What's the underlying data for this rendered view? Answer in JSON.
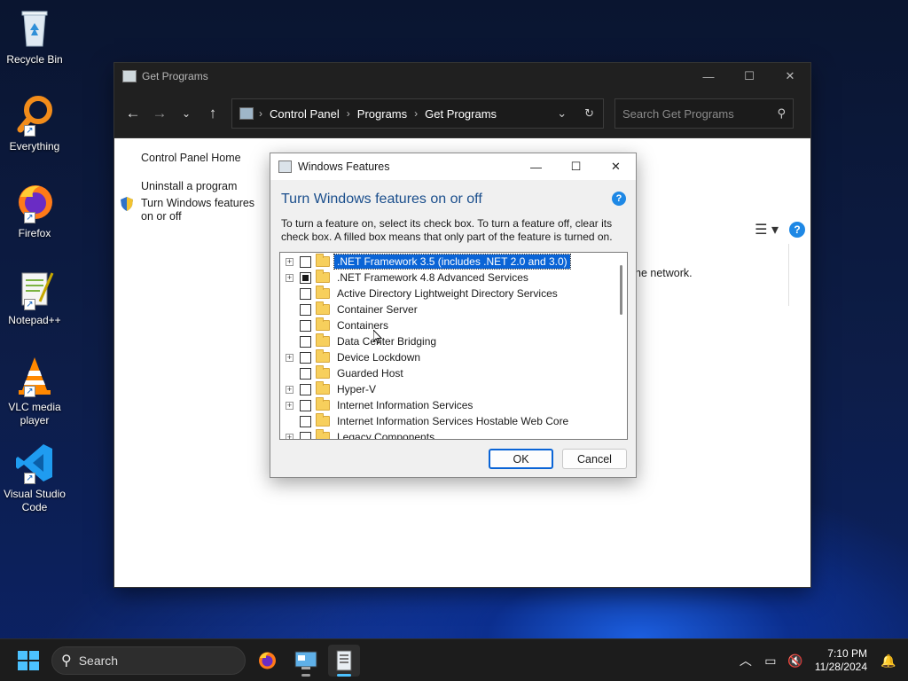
{
  "desktop": {
    "icons": [
      {
        "label": "Recycle Bin"
      },
      {
        "label": "Everything"
      },
      {
        "label": "Firefox"
      },
      {
        "label": "Notepad++"
      },
      {
        "label": "VLC media player"
      },
      {
        "label": "Visual Studio Code"
      }
    ]
  },
  "explorer": {
    "title": "Get Programs",
    "breadcrumb": [
      "Control Panel",
      "Programs",
      "Get Programs"
    ],
    "search_placeholder": "Search Get Programs",
    "sidebar": {
      "home": "Control Panel Home",
      "uninstall": "Uninstall a program",
      "features": "Turn Windows features on or off"
    },
    "partial_text": "he network."
  },
  "dialog": {
    "title": "Windows Features",
    "heading": "Turn Windows features on or off",
    "description": "To turn a feature on, select its check box. To turn a feature off, clear its check box. A filled box means that only part of the feature is turned on.",
    "features": [
      {
        "label": ".NET Framework 3.5 (includes .NET 2.0 and 3.0)",
        "expandable": true,
        "state": "unchecked",
        "selected": true
      },
      {
        "label": ".NET Framework 4.8 Advanced Services",
        "expandable": true,
        "state": "partial",
        "selected": false
      },
      {
        "label": "Active Directory Lightweight Directory Services",
        "expandable": false,
        "state": "unchecked",
        "selected": false
      },
      {
        "label": "Container Server",
        "expandable": false,
        "state": "unchecked",
        "selected": false
      },
      {
        "label": "Containers",
        "expandable": false,
        "state": "unchecked",
        "selected": false
      },
      {
        "label": "Data Center Bridging",
        "expandable": false,
        "state": "unchecked",
        "selected": false
      },
      {
        "label": "Device Lockdown",
        "expandable": true,
        "state": "unchecked",
        "selected": false
      },
      {
        "label": "Guarded Host",
        "expandable": false,
        "state": "unchecked",
        "selected": false
      },
      {
        "label": "Hyper-V",
        "expandable": true,
        "state": "unchecked",
        "selected": false
      },
      {
        "label": "Internet Information Services",
        "expandable": true,
        "state": "unchecked",
        "selected": false
      },
      {
        "label": "Internet Information Services Hostable Web Core",
        "expandable": false,
        "state": "unchecked",
        "selected": false
      },
      {
        "label": "Legacy Components",
        "expandable": true,
        "state": "unchecked",
        "selected": false
      }
    ],
    "ok_label": "OK",
    "cancel_label": "Cancel"
  },
  "taskbar": {
    "search_label": "Search",
    "apps": [
      "Firefox",
      "Control Panel",
      "Windows Features"
    ],
    "time": "7:10 PM",
    "date": "11/28/2024"
  },
  "colors": {
    "accent": "#0a64d6",
    "heading_blue": "#1a4e8c",
    "taskbar": "#1c1c1c"
  }
}
